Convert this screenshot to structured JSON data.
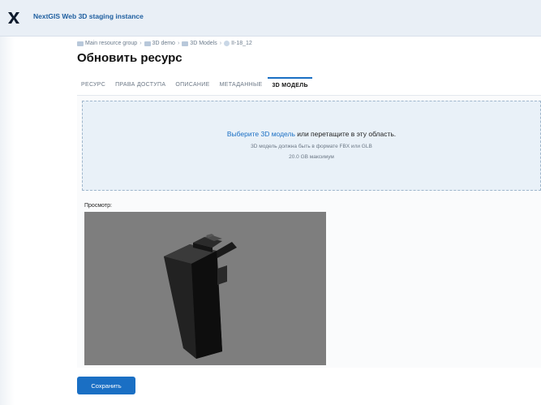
{
  "header": {
    "app_title": "NextGIS Web 3D staging instance",
    "logo_icon": "nextgis-x-logo"
  },
  "breadcrumb": {
    "items": [
      {
        "label": "Main resource group",
        "icon": "folder-icon"
      },
      {
        "label": "3D demo",
        "icon": "folder-icon"
      },
      {
        "label": "3D Models",
        "icon": "folder-icon"
      },
      {
        "label": "II-18_12",
        "icon": "model-icon"
      }
    ],
    "separator": "›"
  },
  "page": {
    "title": "Обновить ресурс"
  },
  "tabs": [
    {
      "label": "РЕСУРС",
      "active": false
    },
    {
      "label": "ПРАВА ДОСТУПА",
      "active": false
    },
    {
      "label": "ОПИСАНИЕ",
      "active": false
    },
    {
      "label": "МЕТАДАННЫЕ",
      "active": false
    },
    {
      "label": "3D МОДЕЛЬ",
      "active": true
    }
  ],
  "upload": {
    "link_text": "Выберите 3D модель",
    "rest_text": " или перетащите в эту область.",
    "hint": "3D модель должна быть в формате FBX или GLB",
    "limit": "20.0 GB максимум"
  },
  "preview": {
    "label": "Просмотр:",
    "background_color": "#7e7e7e"
  },
  "actions": {
    "save_label": "Сохранить"
  },
  "colors": {
    "accent": "#1a6fc4",
    "header_bg": "#e9eff6",
    "dropzone_bg": "#e9f1f8"
  }
}
